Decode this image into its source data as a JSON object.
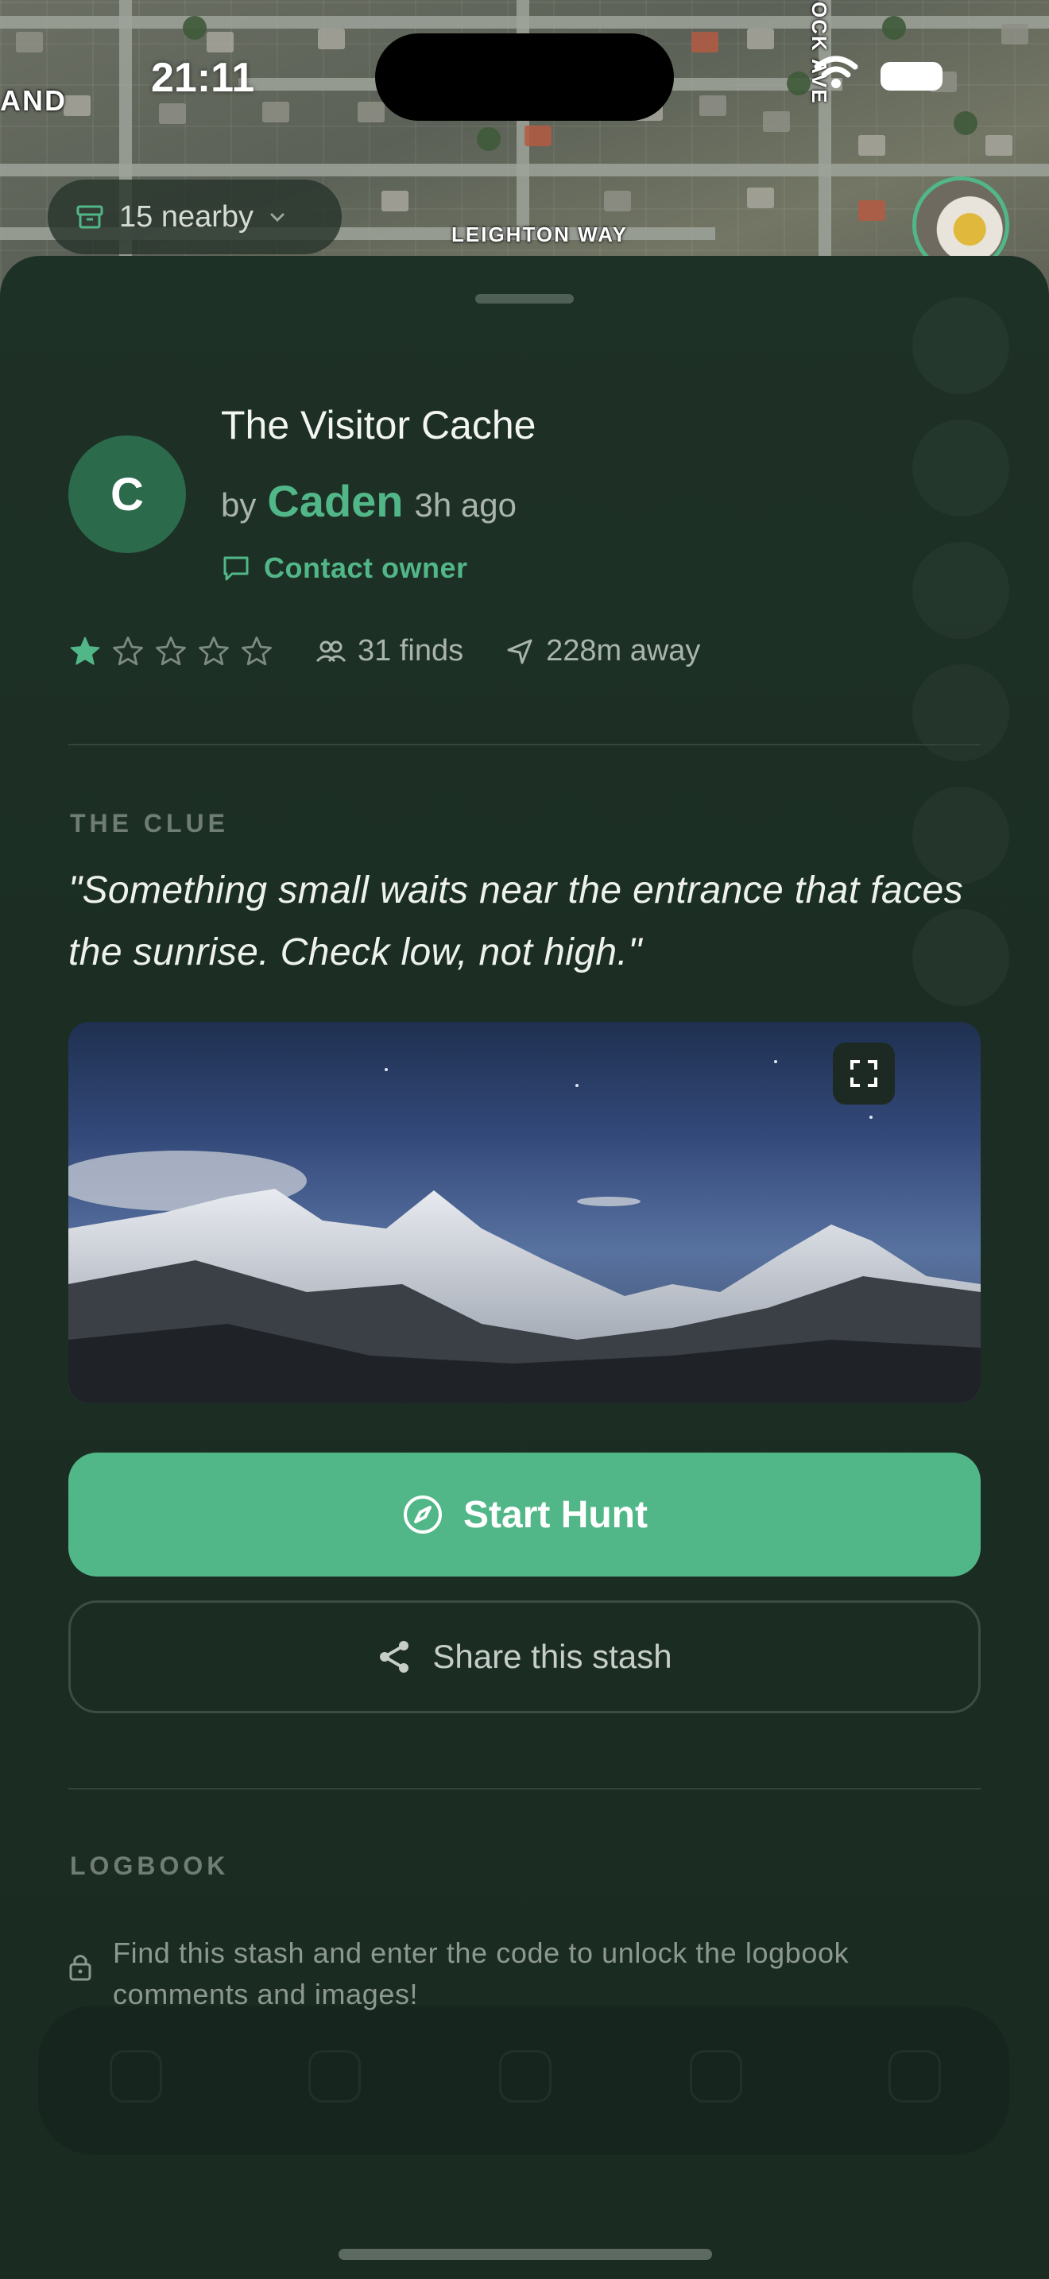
{
  "status_bar": {
    "time": "21:11"
  },
  "map": {
    "street_labels": [
      "LEIGHTON WAY",
      "OCK AVE",
      "AND"
    ],
    "nearby": {
      "label": "15 nearby"
    }
  },
  "cache": {
    "title": "The Visitor Cache",
    "by_prefix": "by",
    "owner_name": "Caden",
    "owner_initial": "C",
    "posted_ago": "3h ago",
    "contact_label": "Contact owner",
    "rating": 1,
    "rating_max": 5,
    "finds": "31 finds",
    "distance": "228m away"
  },
  "clue": {
    "section_label": "THE CLUE",
    "text": "\"Something small waits near the entrance that faces the sunrise. Check low, not high.\""
  },
  "actions": {
    "start_hunt": "Start Hunt",
    "share": "Share this stash"
  },
  "logbook": {
    "section_label": "LOGBOOK",
    "locked_message": "Find this stash and enter the code to unlock the logbook comments and images!"
  },
  "colors": {
    "accent": "#52b788",
    "sheet_bg": "#1e3127",
    "owner_avatar": "#2b6b4b"
  },
  "icons": [
    "cache-box-icon",
    "chevron-down-icon",
    "chat-bubble-icon",
    "star-icon",
    "users-icon",
    "navigation-arrow-icon",
    "expand-icon",
    "compass-icon",
    "share-icon",
    "lock-icon"
  ]
}
